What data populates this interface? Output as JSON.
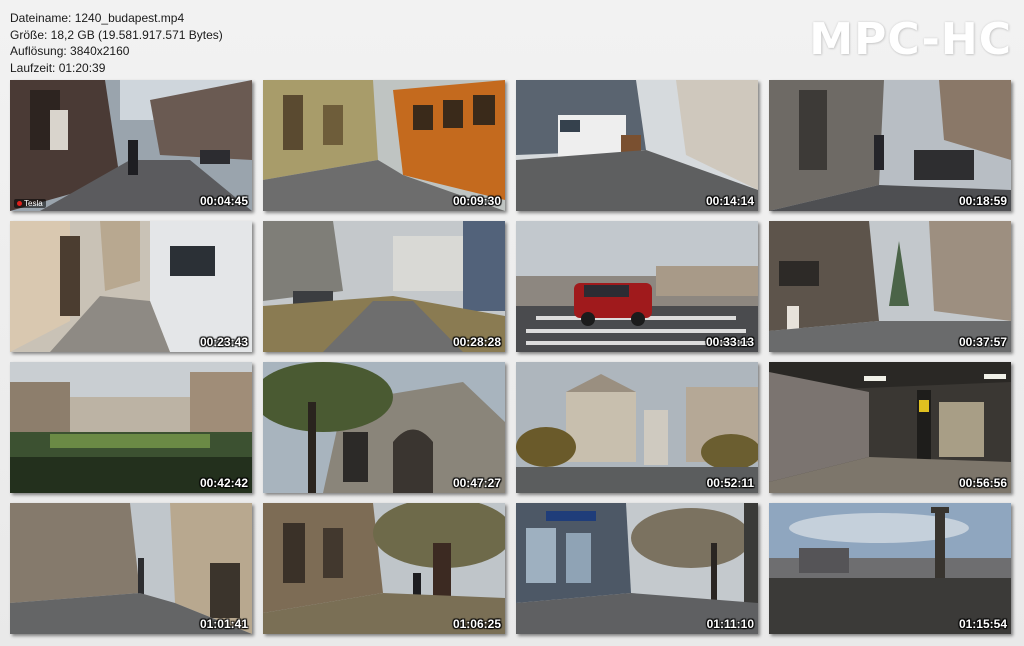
{
  "file_info": {
    "filename": "Dateiname: 1240_budapest.mp4",
    "size": "Größe: 18,2 GB (19.581.917.571 Bytes)",
    "resolution": "Auflösung: 3840x2160",
    "duration": "Laufzeit: 01:20:39"
  },
  "brand": "MPC-HC",
  "thumbnails": [
    {
      "time": "00:04:45"
    },
    {
      "time": "00:09:30"
    },
    {
      "time": "00:14:14"
    },
    {
      "time": "00:18:59"
    },
    {
      "time": "00:23:43"
    },
    {
      "time": "00:28:28"
    },
    {
      "time": "00:33:13"
    },
    {
      "time": "00:37:57"
    },
    {
      "time": "00:42:42"
    },
    {
      "time": "00:47:27"
    },
    {
      "time": "00:52:11"
    },
    {
      "time": "00:56:56"
    },
    {
      "time": "01:01:41"
    },
    {
      "time": "01:06:25"
    },
    {
      "time": "01:11:10"
    },
    {
      "time": "01:15:54"
    }
  ],
  "first_thumb_badge": "Tesla"
}
